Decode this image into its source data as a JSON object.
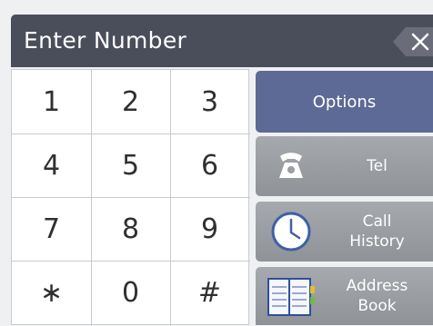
{
  "header": {
    "title": "Enter Number"
  },
  "keypad": {
    "keys": [
      {
        "label": "1"
      },
      {
        "label": "2"
      },
      {
        "label": "3"
      },
      {
        "label": "4"
      },
      {
        "label": "5"
      },
      {
        "label": "6"
      },
      {
        "label": "7"
      },
      {
        "label": "8"
      },
      {
        "label": "9"
      },
      {
        "label": "∗"
      },
      {
        "label": "0"
      },
      {
        "label": "#"
      }
    ]
  },
  "side_menu": {
    "options": {
      "label": "Options"
    },
    "tel": {
      "label": "Tel",
      "icon": "telephone-icon"
    },
    "call_history": {
      "line1": "Call",
      "line2": "History",
      "icon": "clock-icon"
    },
    "address_book": {
      "line1": "Address",
      "line2": "Book",
      "icon": "book-icon"
    }
  },
  "colors": {
    "header_bg": "#4a4d5a",
    "options_bg": "#5d6a95",
    "button_gray": "#9b9ea3",
    "keypad_bg": "#ffffff"
  }
}
